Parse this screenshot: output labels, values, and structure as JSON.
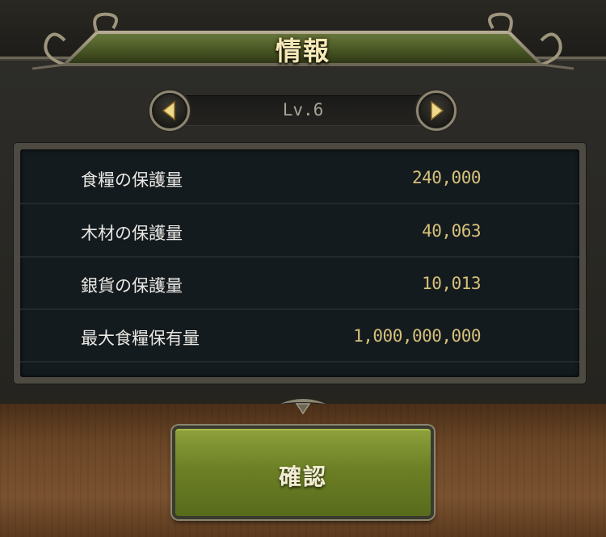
{
  "dialog": {
    "title": "情報"
  },
  "level": {
    "label": "Lv.6"
  },
  "info": {
    "rows": [
      {
        "label": "食糧の保護量",
        "value": "240,000"
      },
      {
        "label": "木材の保護量",
        "value": "40,063"
      },
      {
        "label": "銀貨の保護量",
        "value": "10,013"
      },
      {
        "label": "最大食糧保有量",
        "value": "1,000,000,000"
      }
    ]
  },
  "actions": {
    "confirm_label": "確認"
  },
  "icons": {
    "prev": "arrow-left-icon",
    "next": "arrow-right-icon"
  },
  "colors": {
    "value_gold": "#d6c07a",
    "button_green": "#6d8025"
  }
}
